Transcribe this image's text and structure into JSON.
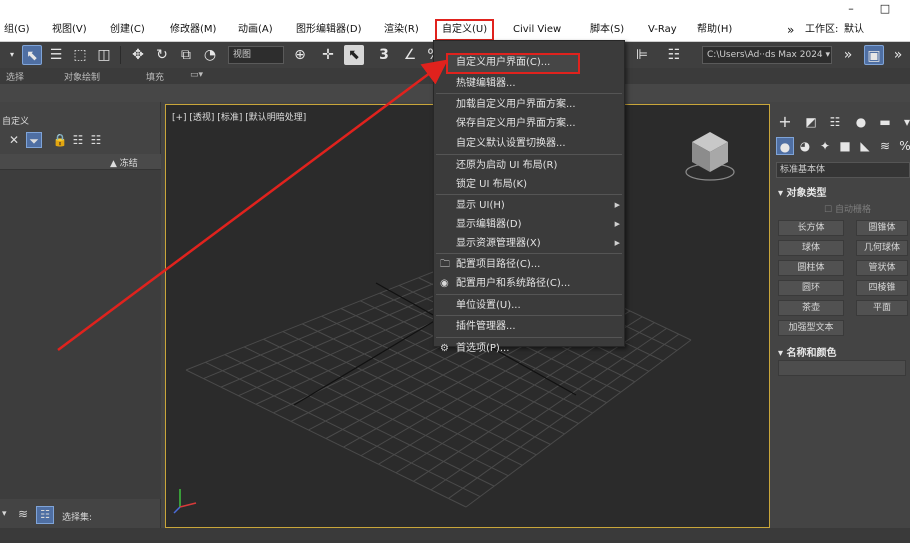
{
  "window": {
    "minimize": "–",
    "maximize": "□"
  },
  "menubar": {
    "items": [
      "组(G)",
      "视图(V)",
      "创建(C)",
      "修改器(M)",
      "动画(A)",
      "图形编辑器(D)",
      "渲染(R)",
      "自定义(U)",
      "Civil View",
      "脚本(S)",
      "V-Ray",
      "帮助(H)"
    ],
    "overflow": "»",
    "workspace_label": "工作区:",
    "workspace_value": "默认"
  },
  "toolbar": {
    "view_dropdown": "视图",
    "path_dropdown": "C:\\Users\\Ad··ds Max 2024 ▾",
    "overflow": "»"
  },
  "ribbon": {
    "select": "选择",
    "object_paint": "对象绘制",
    "fill": "填充"
  },
  "scene_explorer": {
    "title": "自定义",
    "column_frozen": "▲ 冻结",
    "selection_set_label": "选择集:"
  },
  "viewport": {
    "label": "[+] [透视] [标准] [默认明暗处理]"
  },
  "command_panel": {
    "category_dropdown": "标准基本体",
    "object_type_header": "对象类型",
    "autogrid": "自动栅格",
    "buttons": [
      "长方体",
      "圆锥体",
      "球体",
      "几何球体",
      "圆柱体",
      "管状体",
      "圆环",
      "四棱锥",
      "茶壶",
      "平面",
      "加强型文本"
    ],
    "name_color_header": "名称和颜色"
  },
  "customize_menu": {
    "items": [
      {
        "label": "自定义用户界面(C)...",
        "highlighted": true
      },
      {
        "label": "热键编辑器..."
      },
      {
        "label": "加载自定义用户界面方案..."
      },
      {
        "label": "保存自定义用户界面方案..."
      },
      {
        "label": "自定义默认设置切换器..."
      },
      {
        "label": "还原为启动 UI 布局(R)"
      },
      {
        "label": "锁定 UI 布局(K)"
      },
      {
        "label": "显示 UI(H)",
        "submenu": true
      },
      {
        "label": "显示编辑器(D)",
        "submenu": true
      },
      {
        "label": "显示资源管理器(X)",
        "submenu": true
      },
      {
        "label": "配置项目路径(C)...",
        "icon": "folder-icon"
      },
      {
        "label": "配置用户和系统路径(C)...",
        "icon": "user-icon"
      },
      {
        "label": "单位设置(U)..."
      },
      {
        "label": "插件管理器..."
      },
      {
        "label": "首选项(P)...",
        "icon": "gear-icon"
      }
    ]
  },
  "annotation": {
    "arrow_color": "#e0221d"
  }
}
